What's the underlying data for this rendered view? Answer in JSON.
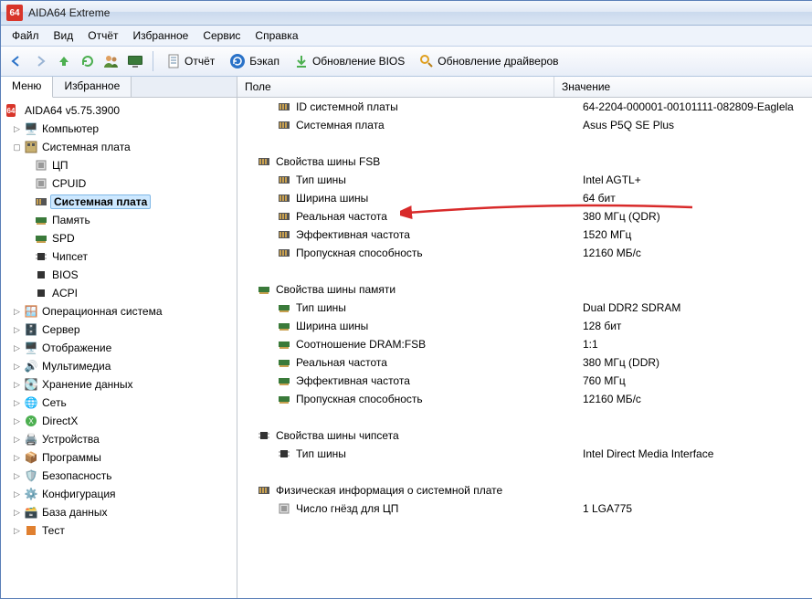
{
  "title": "AIDA64 Extreme",
  "menubar": [
    "Файл",
    "Вид",
    "Отчёт",
    "Избранное",
    "Сервис",
    "Справка"
  ],
  "toolbar": {
    "report": "Отчёт",
    "backup": "Бэкап",
    "bios_update": "Обновление BIOS",
    "driver_update": "Обновление драйверов"
  },
  "side_tabs": {
    "menu": "Меню",
    "fav": "Избранное"
  },
  "tree": {
    "root": "AIDA64 v5.75.3900",
    "computer": "Компьютер",
    "mb": "Системная плата",
    "mb_children": {
      "cpu": "ЦП",
      "cpuid": "CPUID",
      "motherboard": "Системная плата",
      "memory": "Память",
      "spd": "SPD",
      "chipset": "Чипсет",
      "bios": "BIOS",
      "acpi": "ACPI"
    },
    "os": "Операционная система",
    "server": "Сервер",
    "display": "Отображение",
    "multimedia": "Мультимедиа",
    "storage": "Хранение данных",
    "network": "Сеть",
    "directx": "DirectX",
    "devices": "Устройства",
    "software": "Программы",
    "security": "Безопасность",
    "config": "Конфигурация",
    "database": "База данных",
    "test": "Тест"
  },
  "columns": {
    "field": "Поле",
    "value": "Значение"
  },
  "rows": [
    {
      "type": "item",
      "indent": 2,
      "icon": "mb",
      "field": "ID системной платы",
      "value": "64-2204-000001-00101111-082809-Eaglela"
    },
    {
      "type": "item",
      "indent": 2,
      "icon": "mb",
      "field": "Системная плата",
      "value": "Asus P5Q SE Plus"
    },
    {
      "type": "spacer"
    },
    {
      "type": "group",
      "indent": 1,
      "icon": "mb",
      "field": "Свойства шины FSB"
    },
    {
      "type": "item",
      "indent": 2,
      "icon": "mb",
      "field": "Тип шины",
      "value": "Intel AGTL+"
    },
    {
      "type": "item",
      "indent": 2,
      "icon": "mb",
      "field": "Ширина шины",
      "value": "64 бит"
    },
    {
      "type": "item",
      "indent": 2,
      "icon": "mb",
      "field": "Реальная частота",
      "value": "380 МГц (QDR)"
    },
    {
      "type": "item",
      "indent": 2,
      "icon": "mb",
      "field": "Эффективная частота",
      "value": "1520 МГц"
    },
    {
      "type": "item",
      "indent": 2,
      "icon": "mb",
      "field": "Пропускная способность",
      "value": "12160 МБ/с"
    },
    {
      "type": "spacer"
    },
    {
      "type": "group",
      "indent": 1,
      "icon": "mem",
      "field": "Свойства шины памяти"
    },
    {
      "type": "item",
      "indent": 2,
      "icon": "mem",
      "field": "Тип шины",
      "value": "Dual DDR2 SDRAM"
    },
    {
      "type": "item",
      "indent": 2,
      "icon": "mem",
      "field": "Ширина шины",
      "value": "128 бит"
    },
    {
      "type": "item",
      "indent": 2,
      "icon": "mem",
      "field": "Соотношение DRAM:FSB",
      "value": "1:1"
    },
    {
      "type": "item",
      "indent": 2,
      "icon": "mem",
      "field": "Реальная частота",
      "value": "380 МГц (DDR)"
    },
    {
      "type": "item",
      "indent": 2,
      "icon": "mem",
      "field": "Эффективная частота",
      "value": "760 МГц"
    },
    {
      "type": "item",
      "indent": 2,
      "icon": "mem",
      "field": "Пропускная способность",
      "value": "12160 МБ/с"
    },
    {
      "type": "spacer"
    },
    {
      "type": "group",
      "indent": 1,
      "icon": "chipset",
      "field": "Свойства шины чипсета"
    },
    {
      "type": "item",
      "indent": 2,
      "icon": "chipset",
      "field": "Тип шины",
      "value": "Intel Direct Media Interface"
    },
    {
      "type": "spacer"
    },
    {
      "type": "group",
      "indent": 1,
      "icon": "mb",
      "field": "Физическая информация о системной плате"
    },
    {
      "type": "item",
      "indent": 2,
      "icon": "cpu",
      "field": "Число гнёзд для ЦП",
      "value": "1 LGA775"
    }
  ]
}
